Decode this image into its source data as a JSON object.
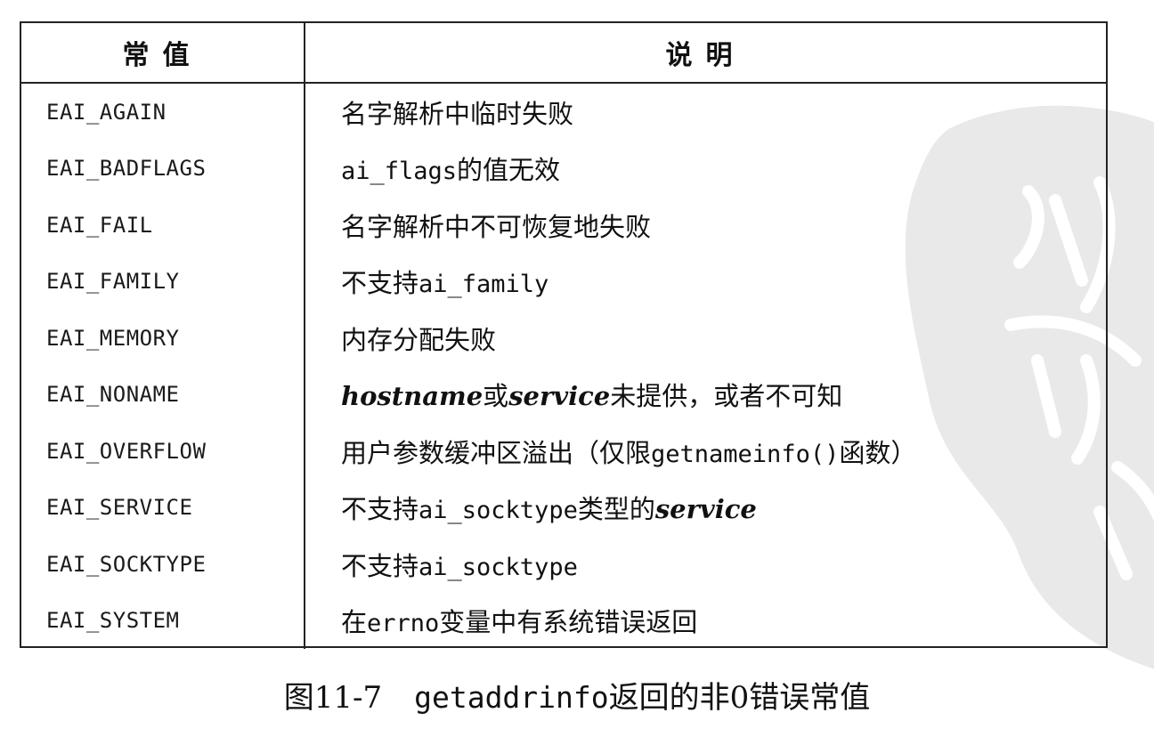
{
  "table": {
    "headers": [
      "常值",
      "说明"
    ],
    "rows": [
      {
        "name": "EAI_AGAIN",
        "desc": [
          {
            "t": "名字解析中临时失败"
          }
        ]
      },
      {
        "name": "EAI_BADFLAGS",
        "desc": [
          {
            "t": "ai_flags",
            "s": "mono"
          },
          {
            "t": "的值无效"
          }
        ]
      },
      {
        "name": "EAI_FAIL",
        "desc": [
          {
            "t": "名字解析中不可恢复地失败"
          }
        ]
      },
      {
        "name": "EAI_FAMILY",
        "desc": [
          {
            "t": "不支持"
          },
          {
            "t": "ai_family",
            "s": "mono"
          }
        ]
      },
      {
        "name": "EAI_MEMORY",
        "desc": [
          {
            "t": "内存分配失败"
          }
        ]
      },
      {
        "name": "EAI_NONAME",
        "desc": [
          {
            "t": "hostname",
            "s": "it"
          },
          {
            "t": "或"
          },
          {
            "t": "service",
            "s": "it"
          },
          {
            "t": "未提供，或者不可知"
          }
        ]
      },
      {
        "name": "EAI_OVERFLOW",
        "desc": [
          {
            "t": "用户参数缓冲区溢出（仅限"
          },
          {
            "t": "getnameinfo()",
            "s": "mono"
          },
          {
            "t": "函数）"
          }
        ]
      },
      {
        "name": "EAI_SERVICE",
        "desc": [
          {
            "t": "不支持"
          },
          {
            "t": "ai_socktype",
            "s": "mono"
          },
          {
            "t": "类型的"
          },
          {
            "t": "service",
            "s": "it"
          }
        ]
      },
      {
        "name": "EAI_SOCKTYPE",
        "desc": [
          {
            "t": "不支持"
          },
          {
            "t": "ai_socktype",
            "s": "mono"
          }
        ]
      },
      {
        "name": "EAI_SYSTEM",
        "desc": [
          {
            "t": "在"
          },
          {
            "t": "errno",
            "s": "mono"
          },
          {
            "t": "变量中有系统错误返回"
          }
        ]
      }
    ]
  },
  "caption": {
    "label": "图11-7",
    "parts": [
      {
        "t": "getaddrinfo",
        "s": "mono"
      },
      {
        "t": "返回的非0错误常值"
      }
    ]
  },
  "watermark": {
    "color": "#e9e9e9"
  }
}
